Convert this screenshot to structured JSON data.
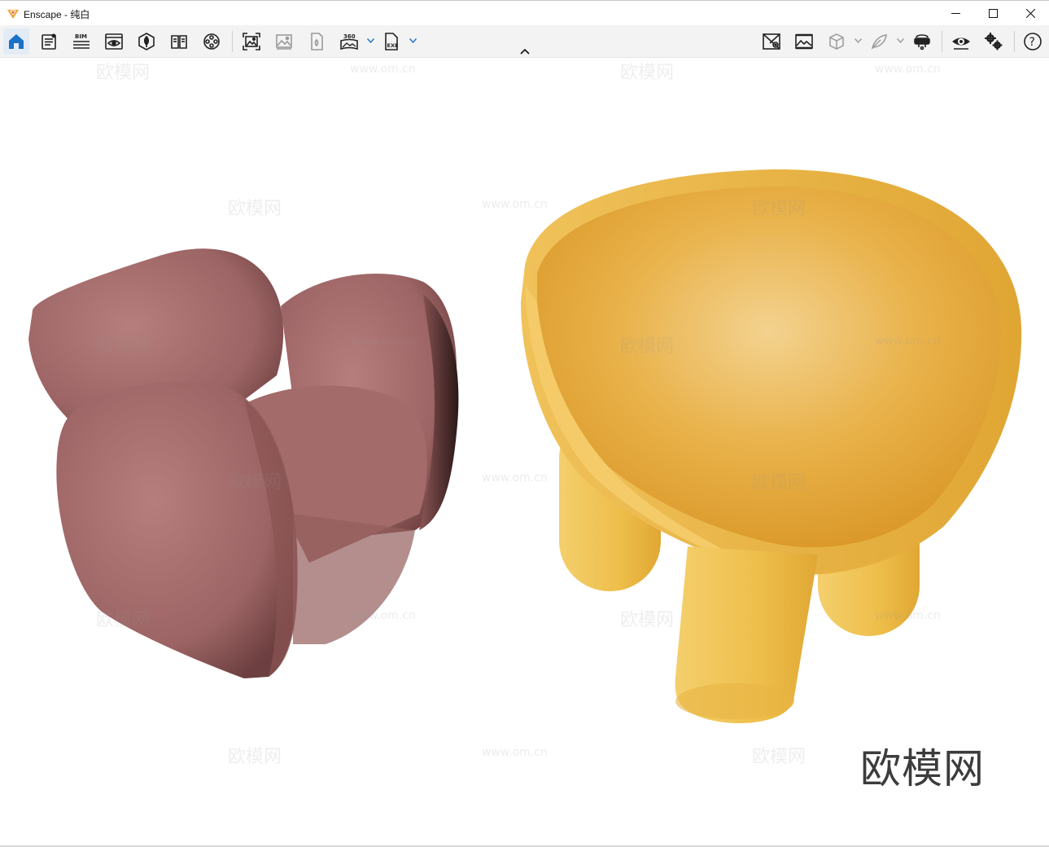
{
  "window": {
    "title": "Enscape - 纯白",
    "controls": {
      "minimize": "minimize",
      "maximize": "maximize",
      "close": "close"
    }
  },
  "toolbar": {
    "left_tools": [
      {
        "id": "home",
        "icon": "home-icon",
        "active": true
      },
      {
        "id": "views",
        "icon": "views-list-icon"
      },
      {
        "id": "bim",
        "icon": "bim-icon",
        "label": "BIM"
      },
      {
        "id": "view-management",
        "icon": "eye-window-icon"
      },
      {
        "id": "asset-library",
        "icon": "asset-library-icon"
      },
      {
        "id": "material-editor",
        "icon": "book-icon"
      },
      {
        "id": "video-editor",
        "icon": "film-reel-icon"
      },
      {
        "id": "render-image",
        "icon": "capture-image-icon"
      },
      {
        "id": "batch-render",
        "icon": "gallery-icon"
      },
      {
        "id": "render-export",
        "icon": "export-file-icon"
      },
      {
        "id": "panorama",
        "icon": "panorama-360-icon",
        "label": "360"
      },
      {
        "id": "exe-export",
        "icon": "exe-file-icon",
        "label": "EXE"
      }
    ],
    "right_tools": [
      {
        "id": "map-view",
        "icon": "map-icon"
      },
      {
        "id": "image-settings",
        "icon": "image-settings-icon"
      },
      {
        "id": "cube-view",
        "icon": "cube-icon"
      },
      {
        "id": "feather",
        "icon": "feather-icon"
      },
      {
        "id": "vr-headset",
        "icon": "vr-headset-icon"
      },
      {
        "id": "visual-settings",
        "icon": "eye-icon"
      },
      {
        "id": "general-settings",
        "icon": "gears-icon"
      },
      {
        "id": "help",
        "icon": "help-icon"
      }
    ]
  },
  "viewport": {
    "watermark": "欧模网",
    "faint_watermark": "欧模网",
    "faint_url": "www.om.cn",
    "scene_objects": [
      "pink-armchair",
      "yellow-tub-chair"
    ]
  },
  "colors": {
    "accent": "#1a73c8",
    "toolbar_bg": "#f3f3f3",
    "pink_chair": "#a46b6b",
    "yellow_chair": "#e9ae3c"
  }
}
